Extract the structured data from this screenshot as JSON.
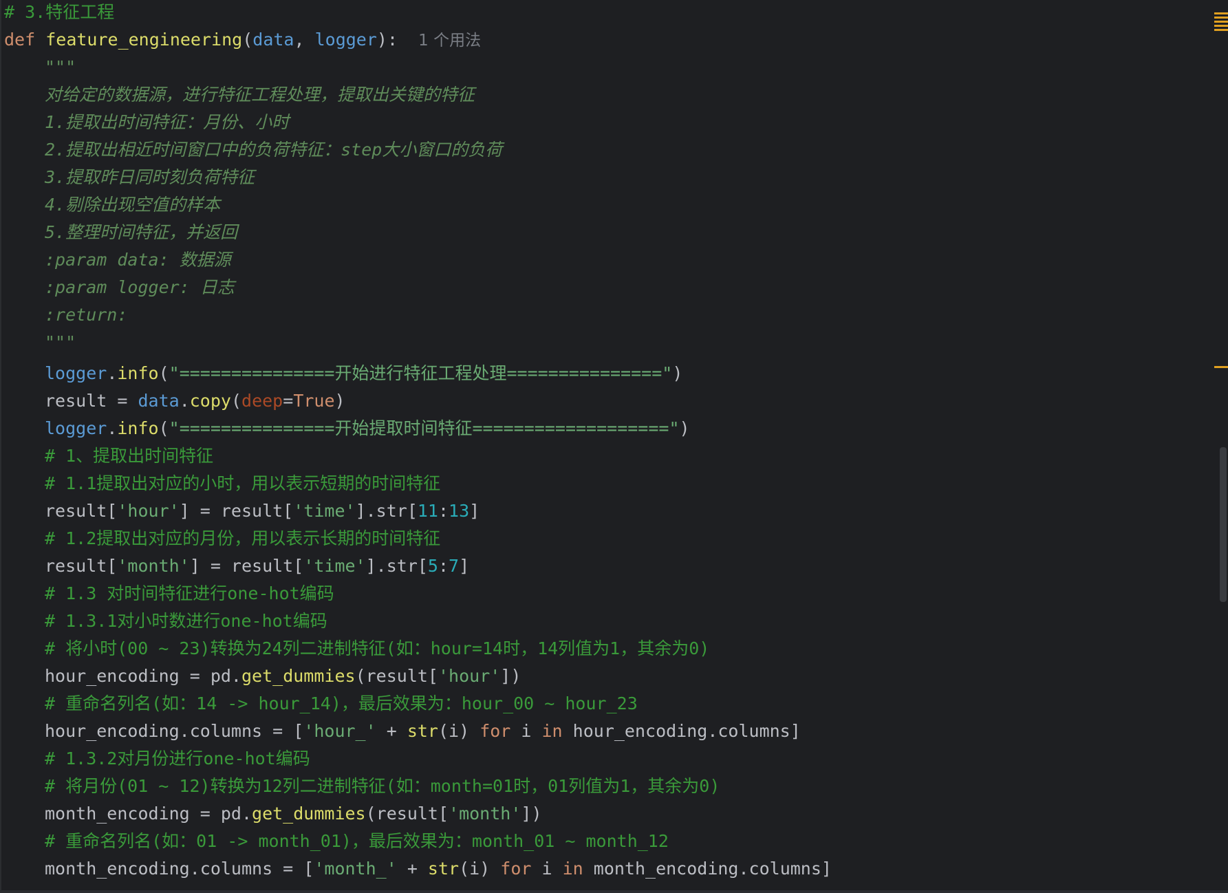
{
  "editor": {
    "lines": [
      {
        "segments": [
          {
            "cls": "comment",
            "text": "# 3.特征工程"
          }
        ]
      },
      {
        "segments": [
          {
            "cls": "kw",
            "text": "def "
          },
          {
            "cls": "fn-yellow",
            "text": "feature_engineering"
          },
          {
            "cls": "plain",
            "text": "("
          },
          {
            "cls": "param",
            "text": "data"
          },
          {
            "cls": "plain",
            "text": ", "
          },
          {
            "cls": "param",
            "text": "logger"
          },
          {
            "cls": "plain",
            "text": "):  "
          },
          {
            "cls": "hint",
            "text": "1 个用法"
          }
        ]
      },
      {
        "segments": [
          {
            "cls": "doc",
            "text": "\"\"\""
          }
        ],
        "indent": true
      },
      {
        "segments": [
          {
            "cls": "doc",
            "text": "对给定的数据源，进行特征工程处理，提取出关键的特征"
          }
        ],
        "indent": true
      },
      {
        "segments": [
          {
            "cls": "doc",
            "text": "1.提取出时间特征：月份、小时"
          }
        ],
        "indent": true
      },
      {
        "segments": [
          {
            "cls": "doc",
            "text": "2.提取出相近时间窗口中的负荷特征：step大小窗口的负荷"
          }
        ],
        "indent": true
      },
      {
        "segments": [
          {
            "cls": "doc",
            "text": "3.提取昨日同时刻负荷特征"
          }
        ],
        "indent": true
      },
      {
        "segments": [
          {
            "cls": "doc",
            "text": "4.剔除出现空值的样本"
          }
        ],
        "indent": true
      },
      {
        "segments": [
          {
            "cls": "doc",
            "text": "5.整理时间特征，并返回"
          }
        ],
        "indent": true
      },
      {
        "segments": [
          {
            "cls": "doc",
            "text": ":param data: 数据源"
          }
        ],
        "indent": true
      },
      {
        "segments": [
          {
            "cls": "doc",
            "text": ":param logger: 日志"
          }
        ],
        "indent": true
      },
      {
        "segments": [
          {
            "cls": "doc",
            "text": ":return:"
          }
        ],
        "indent": true
      },
      {
        "segments": [
          {
            "cls": "doc",
            "text": "\"\"\""
          }
        ],
        "indent": true
      },
      {
        "segments": [
          {
            "cls": "param",
            "text": "logger"
          },
          {
            "cls": "plain",
            "text": "."
          },
          {
            "cls": "fn-yellow",
            "text": "info"
          },
          {
            "cls": "plain",
            "text": "("
          },
          {
            "cls": "str",
            "text": "\"===============开始进行特征工程处理===============\""
          },
          {
            "cls": "plain",
            "text": ")"
          }
        ],
        "indent": true
      },
      {
        "segments": [
          {
            "cls": "plain",
            "text": "result = "
          },
          {
            "cls": "param",
            "text": "data"
          },
          {
            "cls": "plain",
            "text": "."
          },
          {
            "cls": "fn-yellow",
            "text": "copy"
          },
          {
            "cls": "plain",
            "text": "("
          },
          {
            "cls": "named-arg",
            "text": "deep"
          },
          {
            "cls": "plain",
            "text": "="
          },
          {
            "cls": "const-true",
            "text": "True"
          },
          {
            "cls": "plain",
            "text": ")"
          }
        ],
        "indent": true
      },
      {
        "segments": [
          {
            "cls": "param",
            "text": "logger"
          },
          {
            "cls": "plain",
            "text": "."
          },
          {
            "cls": "fn-yellow",
            "text": "info"
          },
          {
            "cls": "plain",
            "text": "("
          },
          {
            "cls": "str",
            "text": "\"===============开始提取时间特征===================\""
          },
          {
            "cls": "plain",
            "text": ")"
          }
        ],
        "indent": true
      },
      {
        "segments": [
          {
            "cls": "comment",
            "text": "# 1、提取出时间特征"
          }
        ],
        "indent": true
      },
      {
        "segments": [
          {
            "cls": "comment",
            "text": "# 1.1提取出对应的小时，用以表示短期的时间特征"
          }
        ],
        "indent": true
      },
      {
        "segments": [
          {
            "cls": "plain",
            "text": "result["
          },
          {
            "cls": "str",
            "text": "'hour'"
          },
          {
            "cls": "plain",
            "text": "] = result["
          },
          {
            "cls": "str",
            "text": "'time'"
          },
          {
            "cls": "plain",
            "text": "].str["
          },
          {
            "cls": "num",
            "text": "11"
          },
          {
            "cls": "plain",
            "text": ":"
          },
          {
            "cls": "num",
            "text": "13"
          },
          {
            "cls": "plain",
            "text": "]"
          }
        ],
        "indent": true
      },
      {
        "segments": [
          {
            "cls": "comment",
            "text": "# 1.2提取出对应的月份，用以表示长期的时间特征"
          }
        ],
        "indent": true
      },
      {
        "segments": [
          {
            "cls": "plain",
            "text": "result["
          },
          {
            "cls": "str",
            "text": "'month'"
          },
          {
            "cls": "plain",
            "text": "] = result["
          },
          {
            "cls": "str",
            "text": "'time'"
          },
          {
            "cls": "plain",
            "text": "].str["
          },
          {
            "cls": "num",
            "text": "5"
          },
          {
            "cls": "plain",
            "text": ":"
          },
          {
            "cls": "num",
            "text": "7"
          },
          {
            "cls": "plain",
            "text": "]"
          }
        ],
        "indent": true
      },
      {
        "segments": [
          {
            "cls": "comment",
            "text": "# 1.3 对时间特征进行one-hot编码"
          }
        ],
        "indent": true
      },
      {
        "segments": [
          {
            "cls": "comment",
            "text": "# 1.3.1对小时数进行one-hot编码"
          }
        ],
        "indent": true
      },
      {
        "segments": [
          {
            "cls": "comment",
            "text": "# 将小时(00 ~ 23)转换为24列二进制特征(如：hour=14时，14列值为1，其余为0)"
          }
        ],
        "indent": true
      },
      {
        "segments": [
          {
            "cls": "plain",
            "text": "hour_encoding = pd."
          },
          {
            "cls": "fn-yellow",
            "text": "get_dummies"
          },
          {
            "cls": "plain",
            "text": "(result["
          },
          {
            "cls": "str",
            "text": "'hour'"
          },
          {
            "cls": "plain",
            "text": "])"
          }
        ],
        "indent": true
      },
      {
        "segments": [
          {
            "cls": "comment",
            "text": "# 重命名列名(如：14 -> hour_14)，最后效果为：hour_00 ~ hour_23"
          }
        ],
        "indent": true
      },
      {
        "segments": [
          {
            "cls": "plain",
            "text": "hour_encoding.columns = ["
          },
          {
            "cls": "str",
            "text": "'hour_'"
          },
          {
            "cls": "plain",
            "text": " + "
          },
          {
            "cls": "fn-yellow",
            "text": "str"
          },
          {
            "cls": "plain",
            "text": "(i) "
          },
          {
            "cls": "kw",
            "text": "for"
          },
          {
            "cls": "plain",
            "text": " i "
          },
          {
            "cls": "kw",
            "text": "in"
          },
          {
            "cls": "plain",
            "text": " hour_encoding.columns]"
          }
        ],
        "indent": true
      },
      {
        "segments": [
          {
            "cls": "comment",
            "text": "# 1.3.2对月份进行one-hot编码"
          }
        ],
        "indent": true
      },
      {
        "segments": [
          {
            "cls": "comment",
            "text": "# 将月份(01 ~ 12)转换为12列二进制特征(如：month=01时，01列值为1，其余为0)"
          }
        ],
        "indent": true
      },
      {
        "segments": [
          {
            "cls": "plain",
            "text": "month_encoding = pd."
          },
          {
            "cls": "fn-yellow",
            "text": "get_dummies"
          },
          {
            "cls": "plain",
            "text": "(result["
          },
          {
            "cls": "str",
            "text": "'month'"
          },
          {
            "cls": "plain",
            "text": "])"
          }
        ],
        "indent": true
      },
      {
        "segments": [
          {
            "cls": "comment",
            "text": "# 重命名列名(如：01 -> month_01)，最后效果为：month_01 ~ month_12"
          }
        ],
        "indent": true
      },
      {
        "segments": [
          {
            "cls": "plain",
            "text": "month_encoding.columns = ["
          },
          {
            "cls": "str",
            "text": "'month_'"
          },
          {
            "cls": "plain",
            "text": " + "
          },
          {
            "cls": "fn-yellow",
            "text": "str"
          },
          {
            "cls": "plain",
            "text": "(i) "
          },
          {
            "cls": "kw",
            "text": "for"
          },
          {
            "cls": "plain",
            "text": " i "
          },
          {
            "cls": "kw",
            "text": "in"
          },
          {
            "cls": "plain",
            "text": " month_encoding.columns]"
          }
        ],
        "indent": true
      }
    ]
  },
  "colors": {
    "background": "#1e1f22",
    "keyword": "#cf8e6d",
    "function": "#dcdc6a",
    "parameter": "#5b9bd5",
    "string": "#6aab73",
    "number": "#2aacb8",
    "comment": "#3a9a3a",
    "docstring": "#5f8c5a",
    "marker": "#e0a020"
  }
}
